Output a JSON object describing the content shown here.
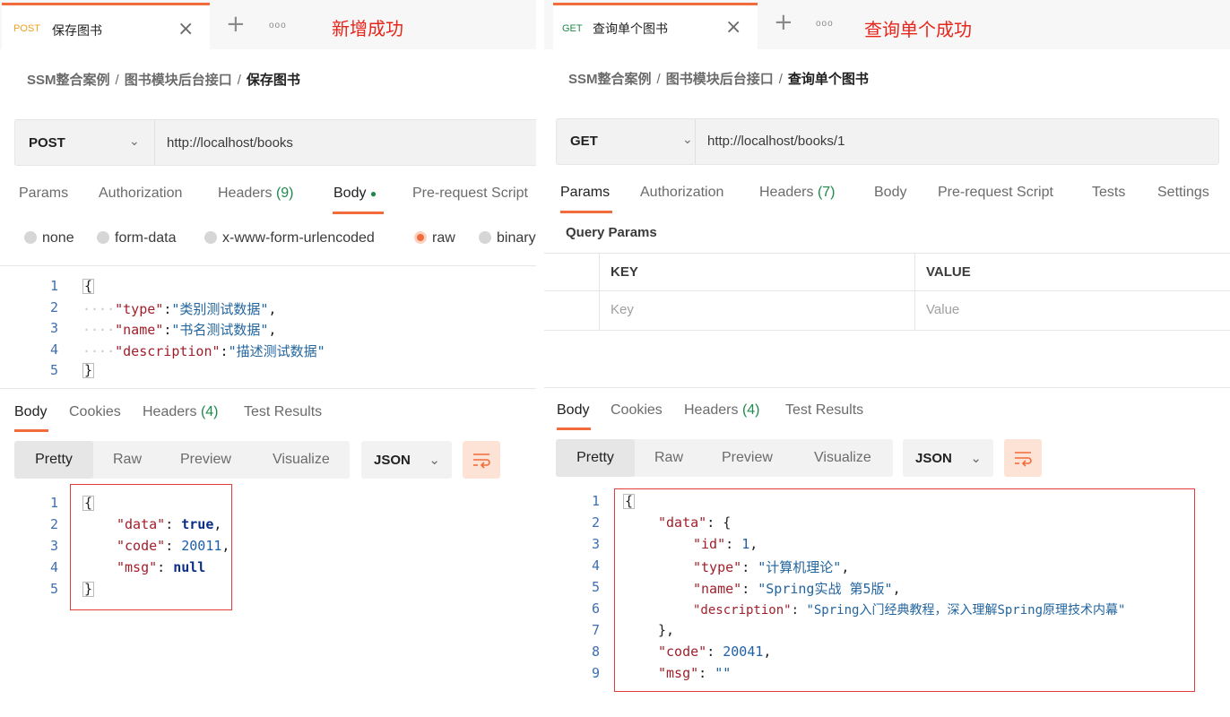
{
  "left": {
    "tab": {
      "method": "POST",
      "name": "保存图书"
    },
    "annotation": "新增成功",
    "breadcrumb": [
      "SSM整合案例",
      "图书模块后台接口",
      "保存图书"
    ],
    "request": {
      "method": "POST",
      "url": "http://localhost/books"
    },
    "request_tabs": [
      {
        "label": "Params"
      },
      {
        "label": "Authorization"
      },
      {
        "label": "Headers",
        "count": "(9)"
      },
      {
        "label": "Body",
        "active": true,
        "indicator": "●"
      },
      {
        "label": "Pre-request Script"
      }
    ],
    "body_types": [
      "none",
      "form-data",
      "x-www-form-urlencoded",
      "raw",
      "binary"
    ],
    "body_selected": "raw",
    "request_body": {
      "line_numbers": [
        "1",
        "2",
        "3",
        "4",
        "5"
      ],
      "open_brace": "{",
      "close_brace": "}",
      "fields": [
        {
          "key": "\"type\"",
          "value": "\"类别测试数据\"",
          "trail": ","
        },
        {
          "key": "\"name\"",
          "value": "\"书名测试数据\"",
          "trail": ","
        },
        {
          "key": "\"description\"",
          "value": "\"描述测试数据\"",
          "trail": ""
        }
      ]
    },
    "response_tabs": [
      {
        "label": "Body",
        "active": true
      },
      {
        "label": "Cookies"
      },
      {
        "label": "Headers",
        "count": "(4)"
      },
      {
        "label": "Test Results"
      }
    ],
    "view_modes": [
      "Pretty",
      "Raw",
      "Preview",
      "Visualize"
    ],
    "format": "JSON",
    "response_body": {
      "line_numbers": [
        "1",
        "2",
        "3",
        "4",
        "5"
      ],
      "open_brace": "{",
      "close_brace": "}",
      "data_key": "\"data\"",
      "data_value": "true",
      "code_key": "\"code\"",
      "code_value": "20011",
      "msg_key": "\"msg\"",
      "msg_value": "null"
    }
  },
  "right": {
    "tab": {
      "method": "GET",
      "name": "查询单个图书"
    },
    "annotation": "查询单个成功",
    "breadcrumb": [
      "SSM整合案例",
      "图书模块后台接口",
      "查询单个图书"
    ],
    "request": {
      "method": "GET",
      "url": "http://localhost/books/1"
    },
    "request_tabs": [
      {
        "label": "Params",
        "active": true
      },
      {
        "label": "Authorization"
      },
      {
        "label": "Headers",
        "count": "(7)"
      },
      {
        "label": "Body"
      },
      {
        "label": "Pre-request Script"
      },
      {
        "label": "Tests"
      },
      {
        "label": "Settings"
      }
    ],
    "query_params": {
      "title": "Query Params",
      "headers": [
        "KEY",
        "VALUE"
      ],
      "placeholders": [
        "Key",
        "Value"
      ]
    },
    "response_tabs": [
      {
        "label": "Body",
        "active": true
      },
      {
        "label": "Cookies"
      },
      {
        "label": "Headers",
        "count": "(4)"
      },
      {
        "label": "Test Results"
      }
    ],
    "view_modes": [
      "Pretty",
      "Raw",
      "Preview",
      "Visualize"
    ],
    "format": "JSON",
    "response_body": {
      "line_numbers": [
        "1",
        "2",
        "3",
        "4",
        "5",
        "6",
        "7",
        "8",
        "9"
      ],
      "open_brace": "{",
      "data_key": "\"data\"",
      "id_key": "\"id\"",
      "id_value": "1",
      "type_key": "\"type\"",
      "type_value": "\"计算机理论\"",
      "name_key": "\"name\"",
      "name_value": "\"Spring实战 第5版\"",
      "description_key": "\"description\"",
      "description_value": "\"Spring入门经典教程，深入理解Spring原理技术内幕\"",
      "data_close": "},",
      "code_key": "\"code\"",
      "code_value": "20041",
      "msg_key": "\"msg\"",
      "msg_value": "\"\""
    }
  },
  "colors": {
    "accent": "#f26b3a",
    "count": "#1f8a4c",
    "annotation": "#e8251a",
    "highlight_box": "#e03d3d"
  },
  "icons": {
    "close": "close-icon",
    "add": "plus-icon",
    "more": "more-icon",
    "dropdown": "chevron-down-icon",
    "wrap": "wrap-lines-icon"
  }
}
